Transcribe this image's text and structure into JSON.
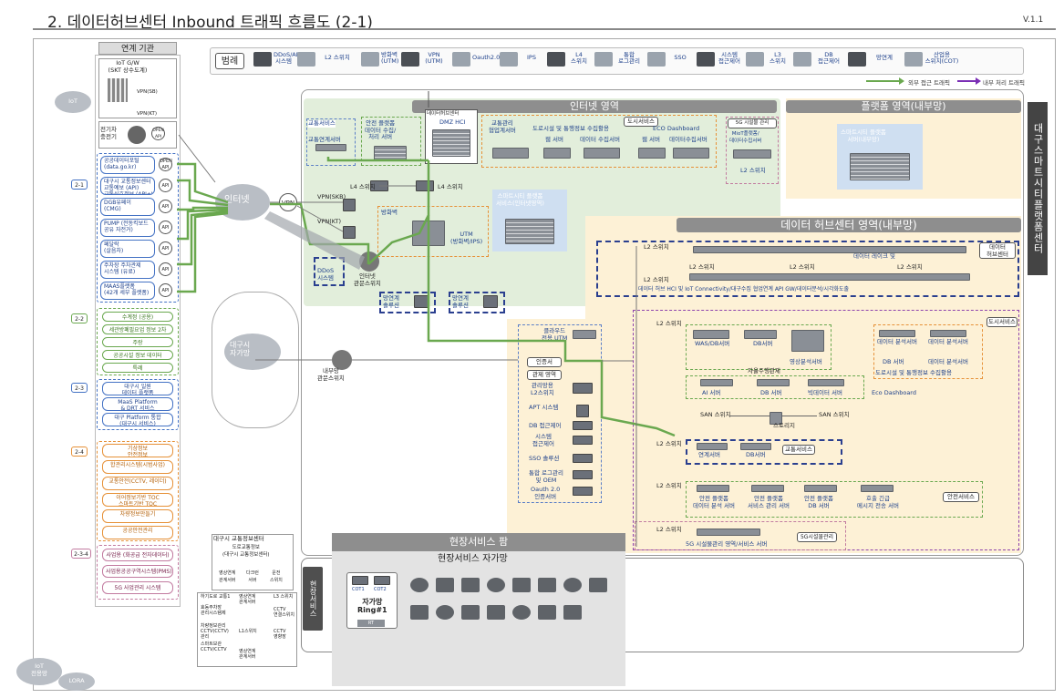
{
  "header": {
    "title": "2. 데이터허브센터 Inbound 트래픽 흐름도 (2-1)",
    "version": "V.1.1"
  },
  "left": {
    "head": "연계 기관",
    "iot_gw": "IoT G/W\n(SKT 상수도계)",
    "vpn_sb": "VPN(SB)",
    "vpn_kt": "VPN(KT)",
    "charger": "전기차\n충전기",
    "group1": [
      {
        "text": "공공데이터포털\n(data.go.kr)",
        "api": "OPEN\nAPI"
      },
      {
        "text": "대구시 교통정보센터\n교통예보 (API)\n교통신호정보 (API+VPN)",
        "api": "API"
      },
      {
        "text": "DGB유페이\n(CMG)",
        "api": "API"
      },
      {
        "text": "PUMP (전동킥보드\n공유 자전거)",
        "api": "API"
      },
      {
        "text": "페달락\n(살음차)",
        "api": "API"
      },
      {
        "text": "주차장 주차관제\n시스템 (유료)",
        "api": "API"
      },
      {
        "text": "MAAS플랫폼\n(42개 세부 플랫폼)",
        "api": "API"
      }
    ],
    "group2": [
      "수계정 (공용)",
      "세관방폐필요업 정보 2차",
      "주랑",
      "공공시설 정보 데이터",
      "특례"
    ],
    "group3": [
      "대구시 일원\n데이터 플랫폼",
      "MaaS Platform\n& DRT 서비스",
      "대구 Platform 통합\n(대구시 서비스)"
    ],
    "group4": [
      "기상정보\n안전정보",
      "합관리시스템(시범사업)",
      "교통안전(CCTV, 레이더)",
      "이어정보기반 TOC\n스마트기반 TOC",
      "차량정보만들기",
      "공공안전관리"
    ],
    "group5": [
      "사업용 (화공급 전자데이터)",
      "사업용공공구역시스템(PMS)",
      "5G 사업관리 시스템"
    ],
    "sidelabels": [
      "2-1",
      "2-2",
      "2-3",
      "2-4",
      "2-3-4"
    ],
    "iot_cloud": "IoT",
    "iot_bottom": "IoT\n전용망",
    "lora": "LORA",
    "traffic_center": {
      "title": "대구시 교통정보센터",
      "sub": "도로교통정보\n(대구시 교통정보센터)",
      "a": "영상연계\n관계서버",
      "b": "다크런\n서버",
      "c": "운전\n스위치"
    },
    "bottom_boxes": [
      "하기도로 교통1",
      "효동주차장\n관리시스템제",
      "차량정보관리\nCCTV(CCTV)\n관리",
      "스마트보관\nCCTV/CCTV",
      "영상연계\n관계서버",
      "L3 스위치",
      "CCTV\n연결스위치",
      "L1스위치",
      "CCTV\n영향장",
      "영상연계\n관계서버"
    ]
  },
  "legend": {
    "title": "범례",
    "items": [
      {
        "label": "DDoS/APT\n시스템",
        "icon": "ddos-icon"
      },
      {
        "label": "L2 스위치",
        "icon": "l2-switch-icon"
      },
      {
        "label": "방화벽\n(UTM)",
        "icon": "firewall-icon"
      },
      {
        "label": "VPN\n(UTM)",
        "icon": "vpn-icon"
      },
      {
        "label": "Oauth2.0",
        "icon": "oauth-icon"
      },
      {
        "label": "IPS",
        "icon": "ips-icon"
      },
      {
        "label": "L4\n스위치",
        "icon": "l4-switch-icon"
      },
      {
        "label": "통합\n로그관리",
        "icon": "log-icon"
      },
      {
        "label": "SSO",
        "icon": "sso-icon"
      },
      {
        "label": "시스템\n접근제어",
        "icon": "access-icon"
      },
      {
        "label": "L3\n스위치",
        "icon": "l3-switch-icon"
      },
      {
        "label": "DB\n접근제어",
        "icon": "db-access-icon"
      },
      {
        "label": "망연계",
        "icon": "network-link-icon"
      },
      {
        "label": "산업용\n스위치(COT)",
        "icon": "industrial-switch-icon"
      }
    ],
    "flow_external": "외부 접근 트래픽",
    "flow_internal": "내부 처리 트래픽",
    "color_external": "#6aa84f",
    "color_internal": "#7b2fb5"
  },
  "zones": {
    "internet": "인터넷 영역",
    "platform": "플랫폼 영역(내부망)",
    "datahub": "데이터 허브센터 영역(내부망)",
    "right_vertical": "대구스마트시티플랫폼센터",
    "field_vertical": "현장서비스",
    "field_service": "현장서비스 팜",
    "field_net": "현장서비스 자가망"
  },
  "internet": {
    "traffic_service": "교통서비스",
    "traffic_server": "교통연계서버",
    "safety": "안전 플랫폼\n데이터 수집/\n처리 서버",
    "datahub_center": "데이터허브센터",
    "dmz_hci": "DMZ HCI",
    "city_service": "도시서비스",
    "eco": "ECO Dashboard",
    "traffic_mgmt": "교통관리\n협업계서버",
    "urban_collect": "도로시설 및 통행정보 수집활용",
    "web_server": "웹 서버",
    "data_collect": "데이터 수집서버",
    "web_server2": "웹 서버",
    "data_collect2": "데이터수집서버",
    "fiveg": "5G 시설물 관리",
    "miot": "MioT플랫폼/\n데이터수집서버",
    "l2": "L2 스위치",
    "l4a": "L4 스위치",
    "l4b": "L4 스위치",
    "vpn_sb": "VPN(SKB)",
    "vpn_kt": "VPN(KT)",
    "fw": "방화벽",
    "utm": "UTM\n(방화벽/IPS)",
    "ddos": "DDoS\n시스템",
    "internet_sw": "인터넷\n관문스위치",
    "smartcity_box": "스마트시티 플랫폼\n서비스(인터넷영역)",
    "internet_cloud": "인터넷",
    "vpn": "VPN",
    "net_link1": "망연계\n솔루션",
    "net_link2": "망연계\n솔루션"
  },
  "platform": {
    "box": "스마트시티 플랫폼\n서버(내부망)"
  },
  "datahub": {
    "l2": "L2 스위치",
    "datalake": "데이터 레이크 및",
    "hci": "데이터 허브 HCI 및 IoT Connectivity/대구수집  협업연계 API GW/데이터분석/시각화도출",
    "datahub_label": "데이터\n허브센터",
    "city_service": "도시서비스",
    "was": "WAS/DB서버",
    "db": "DB서버",
    "video": "영상분석서버",
    "data_analysis": "데이터 분석서버",
    "data_analysis2": "데이터 분석서버",
    "db2": "DB 서버",
    "data_analysis3": "데이터 분석서버",
    "road_info": "도로시설 및 통행정보 수집활용",
    "autonomous": "자율주행관제",
    "ai": "AI 서버",
    "db3": "DB 서버",
    "bigdata": "빅데이터 서버",
    "eco": "Eco Dashboard",
    "san": "SAN 스위치",
    "san2": "SAN 스위치",
    "storage": "스토리지",
    "traffic_service": "교통서비스",
    "link_server": "연계서버",
    "db4": "DB서버",
    "safety_service": "안전서비스",
    "safety1": "안전 플랫폼\n데이터 분석 서버",
    "safety2": "안전 플랫폼\n서비스 관리 서버",
    "safety3": "안전 플랫폼\nDB 서버",
    "safety4": "호출 긴급\n메시지 전송 서버",
    "fiveg": "5G시설물관리",
    "fiveg_server": "5G 시설물관리 영역/서비스 서버"
  },
  "lower": {
    "cloud_utm": "클라우드\n전용 UTM",
    "auth": "인증서",
    "mgmt": "관제 영역",
    "mgmt_l2": "관리망용\nL2스위치",
    "apt": "APT 시스템",
    "db_access": "DB 접근제어",
    "sys_access": "시스템\n접근제어",
    "sso": "SSO 솔루션",
    "log": "통합 로그관리\n및 OEM",
    "oauth": "Oauth 2.0\n인증서버",
    "inner_sw": "내부망\n관문스위치",
    "daegu_net": "대구시\n자가망"
  },
  "field": {
    "cot1": "COT1",
    "cot2": "COT2",
    "ring": "자가망\nRing#1",
    "rt": "RT"
  }
}
